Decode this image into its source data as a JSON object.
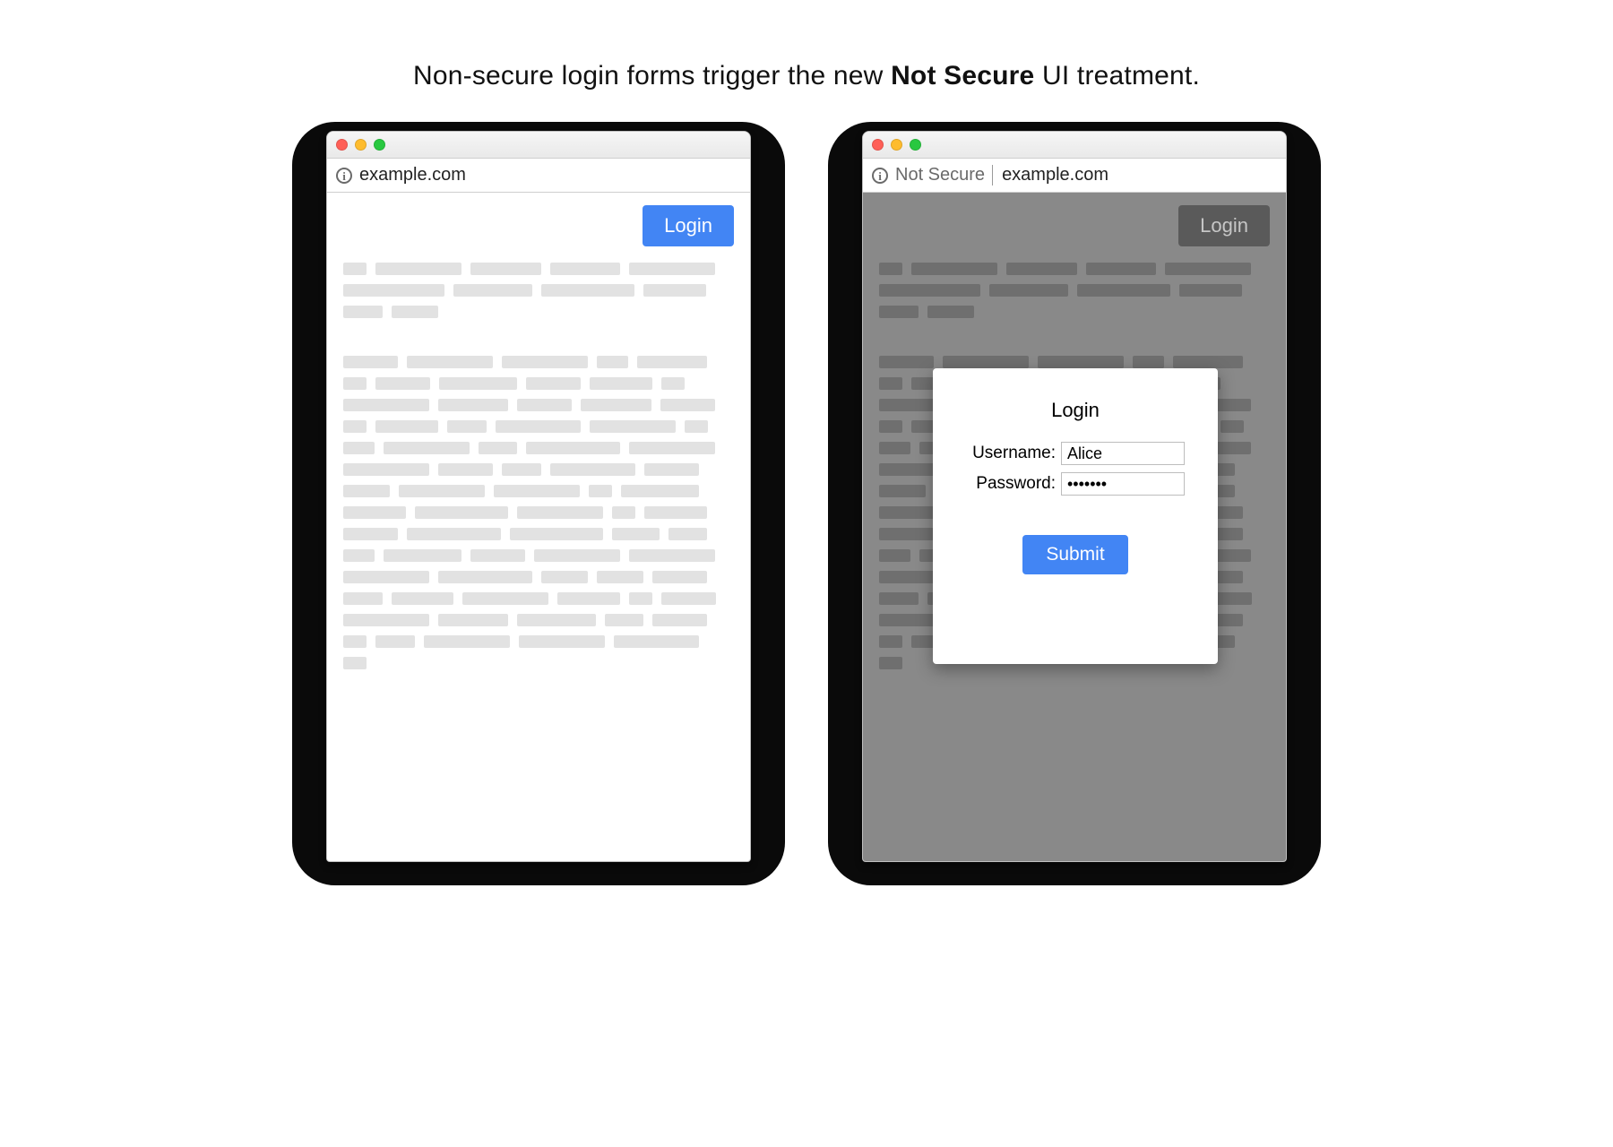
{
  "caption": {
    "prefix": "Non-secure login forms trigger the new ",
    "emphasis": "Not Secure",
    "suffix": " UI treatment."
  },
  "left_window": {
    "url": "example.com",
    "login_button": "Login"
  },
  "right_window": {
    "not_secure_label": "Not Secure",
    "url": "example.com",
    "login_button": "Login",
    "modal": {
      "title": "Login",
      "username_label": "Username:",
      "username_value": "Alice",
      "password_label": "Password:",
      "password_value": "•••••••",
      "submit_label": "Submit"
    }
  }
}
